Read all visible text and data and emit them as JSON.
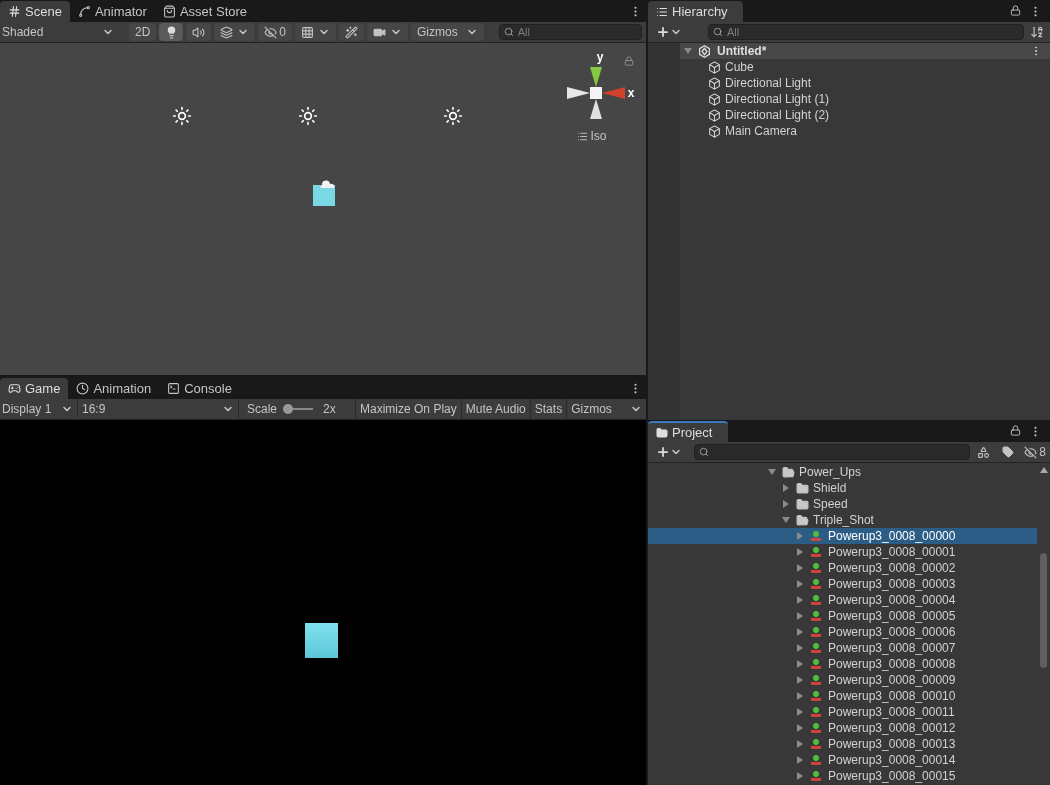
{
  "scene_panel": {
    "tabs": [
      {
        "label": "Scene",
        "selected": true
      },
      {
        "label": "Animator",
        "selected": false
      },
      {
        "label": "Asset Store",
        "selected": false
      }
    ],
    "toolbar": {
      "draw_mode": "Shaded",
      "mode_2d": "2D",
      "lighting_on": true,
      "hidden_count": "0",
      "gizmos": "Gizmos",
      "search_placeholder": "All"
    },
    "gizmo": {
      "y_label": "y",
      "x_label": "x",
      "projection": "Iso"
    }
  },
  "game_panel": {
    "tabs": [
      {
        "label": "Game",
        "selected": true
      },
      {
        "label": "Animation",
        "selected": false
      },
      {
        "label": "Console",
        "selected": false
      }
    ],
    "toolbar": {
      "display": "Display 1",
      "aspect": "16:9",
      "scale_label": "Scale",
      "scale_value": "2x",
      "buttons": [
        "Maximize On Play",
        "Mute Audio",
        "Stats",
        "Gizmos"
      ]
    }
  },
  "hierarchy": {
    "tab": "Hierarchy",
    "search_placeholder": "All",
    "scene": {
      "name": "Untitled*",
      "expanded": true,
      "children": [
        "Cube",
        "Directional Light",
        "Directional Light (1)",
        "Directional Light (2)",
        "Main Camera"
      ]
    }
  },
  "project": {
    "tab": "Project",
    "hidden_count": "8",
    "tree": [
      {
        "name": "Power_Ups",
        "kind": "folder",
        "expanded": true,
        "selected": false,
        "children": [
          {
            "name": "Shield",
            "kind": "folder",
            "expanded": false,
            "selected": false
          },
          {
            "name": "Speed",
            "kind": "folder",
            "expanded": false,
            "selected": false
          },
          {
            "name": "Triple_Shot",
            "kind": "folder",
            "expanded": true,
            "selected": false,
            "children": [
              {
                "name": "Powerup3_0008_00000",
                "kind": "sprite",
                "expanded": false,
                "selected": true
              },
              {
                "name": "Powerup3_0008_00001",
                "kind": "sprite",
                "expanded": false,
                "selected": false
              },
              {
                "name": "Powerup3_0008_00002",
                "kind": "sprite",
                "expanded": false,
                "selected": false
              },
              {
                "name": "Powerup3_0008_00003",
                "kind": "sprite",
                "expanded": false,
                "selected": false
              },
              {
                "name": "Powerup3_0008_00004",
                "kind": "sprite",
                "expanded": false,
                "selected": false
              },
              {
                "name": "Powerup3_0008_00005",
                "kind": "sprite",
                "expanded": false,
                "selected": false
              },
              {
                "name": "Powerup3_0008_00006",
                "kind": "sprite",
                "expanded": false,
                "selected": false
              },
              {
                "name": "Powerup3_0008_00007",
                "kind": "sprite",
                "expanded": false,
                "selected": false
              },
              {
                "name": "Powerup3_0008_00008",
                "kind": "sprite",
                "expanded": false,
                "selected": false
              },
              {
                "name": "Powerup3_0008_00009",
                "kind": "sprite",
                "expanded": false,
                "selected": false
              },
              {
                "name": "Powerup3_0008_00010",
                "kind": "sprite",
                "expanded": false,
                "selected": false
              },
              {
                "name": "Powerup3_0008_00011",
                "kind": "sprite",
                "expanded": false,
                "selected": false
              },
              {
                "name": "Powerup3_0008_00012",
                "kind": "sprite",
                "expanded": false,
                "selected": false
              },
              {
                "name": "Powerup3_0008_00013",
                "kind": "sprite",
                "expanded": false,
                "selected": false
              },
              {
                "name": "Powerup3_0008_00014",
                "kind": "sprite",
                "expanded": false,
                "selected": false
              },
              {
                "name": "Powerup3_0008_00015",
                "kind": "sprite",
                "expanded": false,
                "selected": false
              }
            ]
          }
        ]
      }
    ]
  }
}
